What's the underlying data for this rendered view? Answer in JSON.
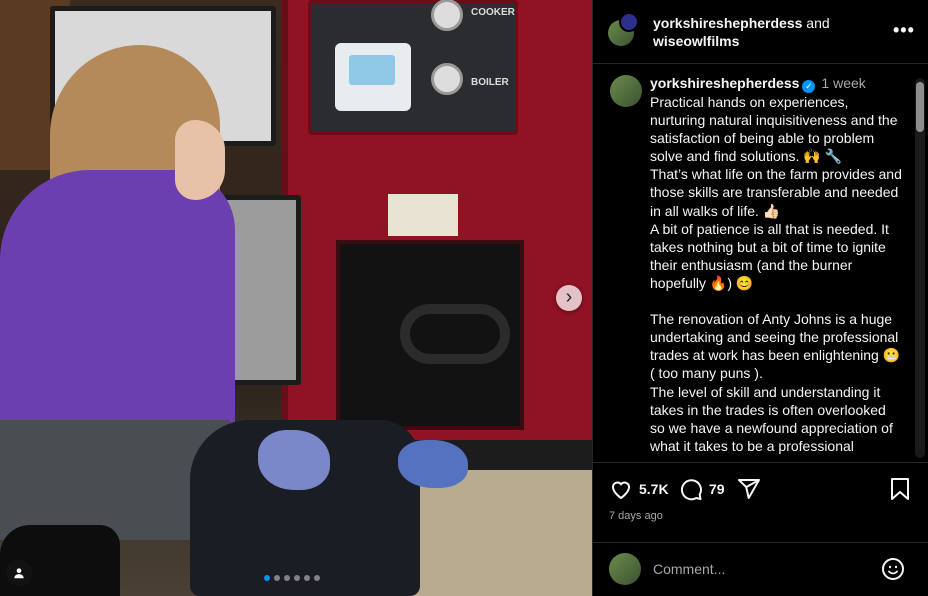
{
  "header": {
    "user1": "yorkshireshepherdess",
    "conjunction": " and",
    "user2": "wiseowlfilms",
    "more_label": "•••"
  },
  "media": {
    "next_label": "›",
    "stove_labels": {
      "cooker": "COOKER",
      "boiler": "BOILER"
    },
    "carousel_dots": 6,
    "active_dot": 0
  },
  "caption": {
    "username": "yorkshireshepherdess",
    "verified": true,
    "time": "1 week",
    "text": "Practical hands on experiences, nurturing natural inquisitiveness and the satisfaction of being able to problem solve and find solutions. 🙌 🔧\nThat’s what life on the farm provides and those skills are transferable and needed in all walks of life. 👍🏻\nA bit of patience is all that is needed. It takes nothing but a bit of time to ignite  their enthusiasm (and the burner hopefully 🔥) 😊\n\nThe renovation of Anty Johns is a huge undertaking and seeing the professional trades at work has been enlightening 😬  ( too many puns ).\nThe level of skill and understanding it takes in the trades is often overlooked so we have a newfound appreciation of what it takes to be a professional"
  },
  "actions": {
    "likes": "5.7K",
    "comments": "79",
    "date": "7 days ago"
  },
  "comment_box": {
    "placeholder": "Comment..."
  },
  "colors": {
    "accent": "#0095f6",
    "background": "#000000",
    "border": "#262626",
    "muted_text": "#a8a8a8"
  },
  "icons": [
    "more-icon",
    "verified-icon",
    "heart-icon",
    "comment-icon",
    "share-icon",
    "bookmark-icon",
    "emoji-icon",
    "tag-user-icon",
    "chevron-right-icon"
  ]
}
